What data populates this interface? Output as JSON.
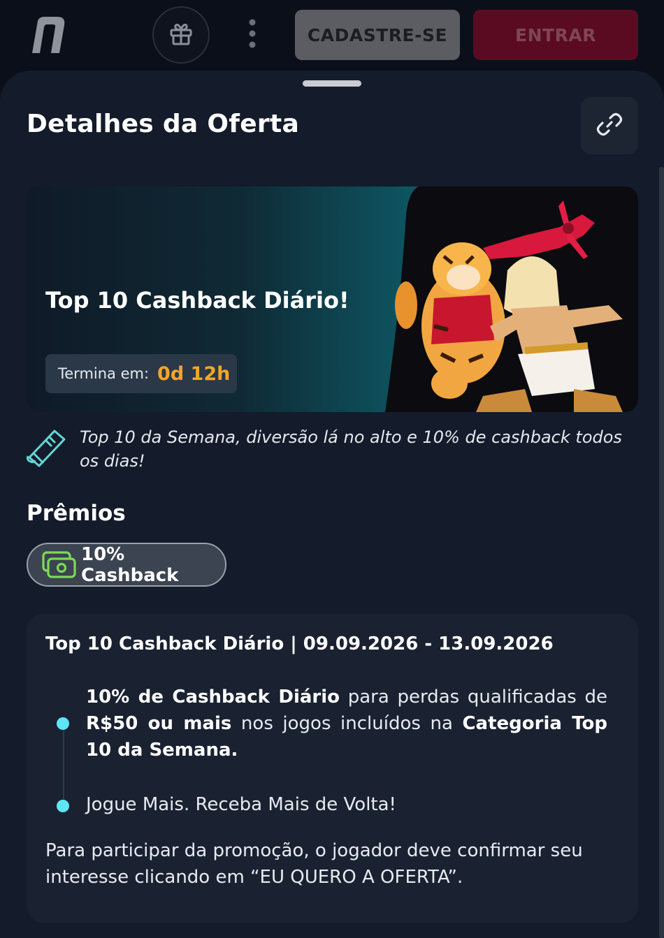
{
  "header": {
    "logo_letter": "n",
    "register_label": "CADASTRE-SE",
    "login_label": "ENTRAR",
    "colors": {
      "register_bg": "#5b5d62",
      "login_bg": "#5a0b21"
    }
  },
  "sheet": {
    "title": "Detalhes da Oferta",
    "banner": {
      "title": "Top 10 Cashback Diário!",
      "ends_label": "Termina em:",
      "ends_value": "0d 12h"
    },
    "description": "Top 10 da Semana, diversão lá no alto e 10% de cashback todos os dias!",
    "prizes_title": "Prêmios",
    "prize_chip_label": "10% Cashback",
    "details": {
      "title": "Top 10 Cashback Diário | 09.09.2026 - 13.09.2026",
      "bullet1": {
        "b1": "10% de Cashback Diário",
        "t1": " para perdas qualificadas de ",
        "b2": "R$50 ou mais",
        "t2": " nos jogos incluídos na ",
        "b3": "Categoria Top 10 da Semana."
      },
      "bullet2": "Jogue Mais. Receba Mais de Volta!",
      "footer": "Para participar da promoção, o jogador deve confirmar seu interesse clicando em “EU QUERO A OFERTA”."
    },
    "icons": [
      "gift-icon",
      "more-vertical-icon",
      "link-icon",
      "ticket-icon",
      "cash-icon"
    ],
    "accent_colors": {
      "timer": "#f5a623",
      "bullet_dot": "#5ee6f5",
      "icon_teal": "#63d7d6",
      "cash_green": "#7ed957"
    }
  }
}
